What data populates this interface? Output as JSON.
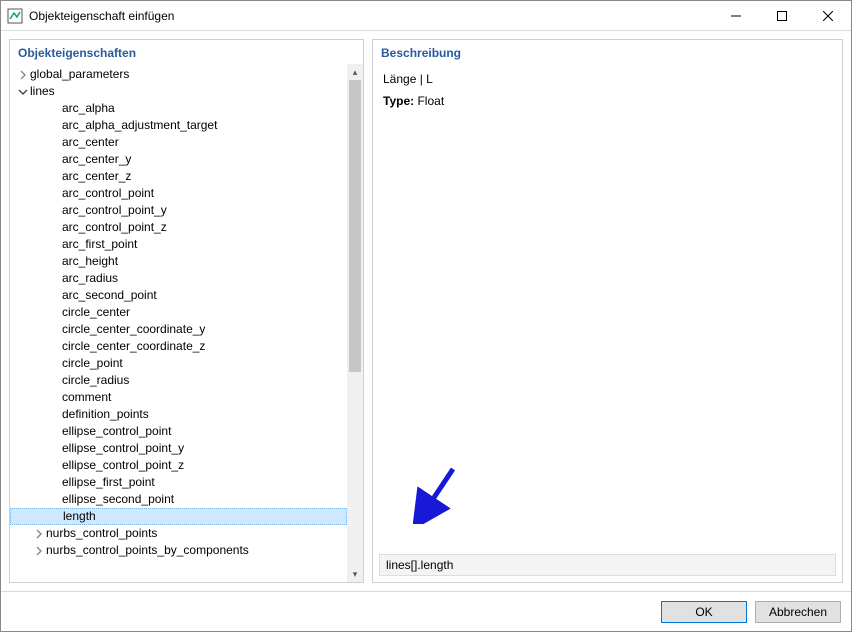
{
  "window": {
    "title": "Objekteigenschaft einfügen"
  },
  "left": {
    "header": "Objekteigenschaften",
    "items": [
      {
        "label": "global_parameters",
        "type": "expandable",
        "expanded": false,
        "indent": 0
      },
      {
        "label": "lines",
        "type": "expandable",
        "expanded": true,
        "indent": 0
      },
      {
        "label": "arc_alpha",
        "type": "leaf",
        "indent": 2
      },
      {
        "label": "arc_alpha_adjustment_target",
        "type": "leaf",
        "indent": 2
      },
      {
        "label": "arc_center",
        "type": "leaf",
        "indent": 2
      },
      {
        "label": "arc_center_y",
        "type": "leaf",
        "indent": 2
      },
      {
        "label": "arc_center_z",
        "type": "leaf",
        "indent": 2
      },
      {
        "label": "arc_control_point",
        "type": "leaf",
        "indent": 2
      },
      {
        "label": "arc_control_point_y",
        "type": "leaf",
        "indent": 2
      },
      {
        "label": "arc_control_point_z",
        "type": "leaf",
        "indent": 2
      },
      {
        "label": "arc_first_point",
        "type": "leaf",
        "indent": 2
      },
      {
        "label": "arc_height",
        "type": "leaf",
        "indent": 2
      },
      {
        "label": "arc_radius",
        "type": "leaf",
        "indent": 2
      },
      {
        "label": "arc_second_point",
        "type": "leaf",
        "indent": 2
      },
      {
        "label": "circle_center",
        "type": "leaf",
        "indent": 2
      },
      {
        "label": "circle_center_coordinate_y",
        "type": "leaf",
        "indent": 2
      },
      {
        "label": "circle_center_coordinate_z",
        "type": "leaf",
        "indent": 2
      },
      {
        "label": "circle_point",
        "type": "leaf",
        "indent": 2
      },
      {
        "label": "circle_radius",
        "type": "leaf",
        "indent": 2
      },
      {
        "label": "comment",
        "type": "leaf",
        "indent": 2
      },
      {
        "label": "definition_points",
        "type": "leaf",
        "indent": 2
      },
      {
        "label": "ellipse_control_point",
        "type": "leaf",
        "indent": 2
      },
      {
        "label": "ellipse_control_point_y",
        "type": "leaf",
        "indent": 2
      },
      {
        "label": "ellipse_control_point_z",
        "type": "leaf",
        "indent": 2
      },
      {
        "label": "ellipse_first_point",
        "type": "leaf",
        "indent": 2
      },
      {
        "label": "ellipse_second_point",
        "type": "leaf",
        "indent": 2
      },
      {
        "label": "length",
        "type": "leaf",
        "indent": 2,
        "selected": true
      },
      {
        "label": "nurbs_control_points",
        "type": "expandable",
        "expanded": false,
        "indent": 1
      },
      {
        "label": "nurbs_control_points_by_components",
        "type": "expandable",
        "expanded": false,
        "indent": 1
      }
    ]
  },
  "right": {
    "header": "Beschreibung",
    "desc": "Länge | L",
    "type_label": "Type:",
    "type_value": "Float",
    "path": "lines[].length"
  },
  "footer": {
    "ok": "OK",
    "cancel": "Abbrechen"
  }
}
